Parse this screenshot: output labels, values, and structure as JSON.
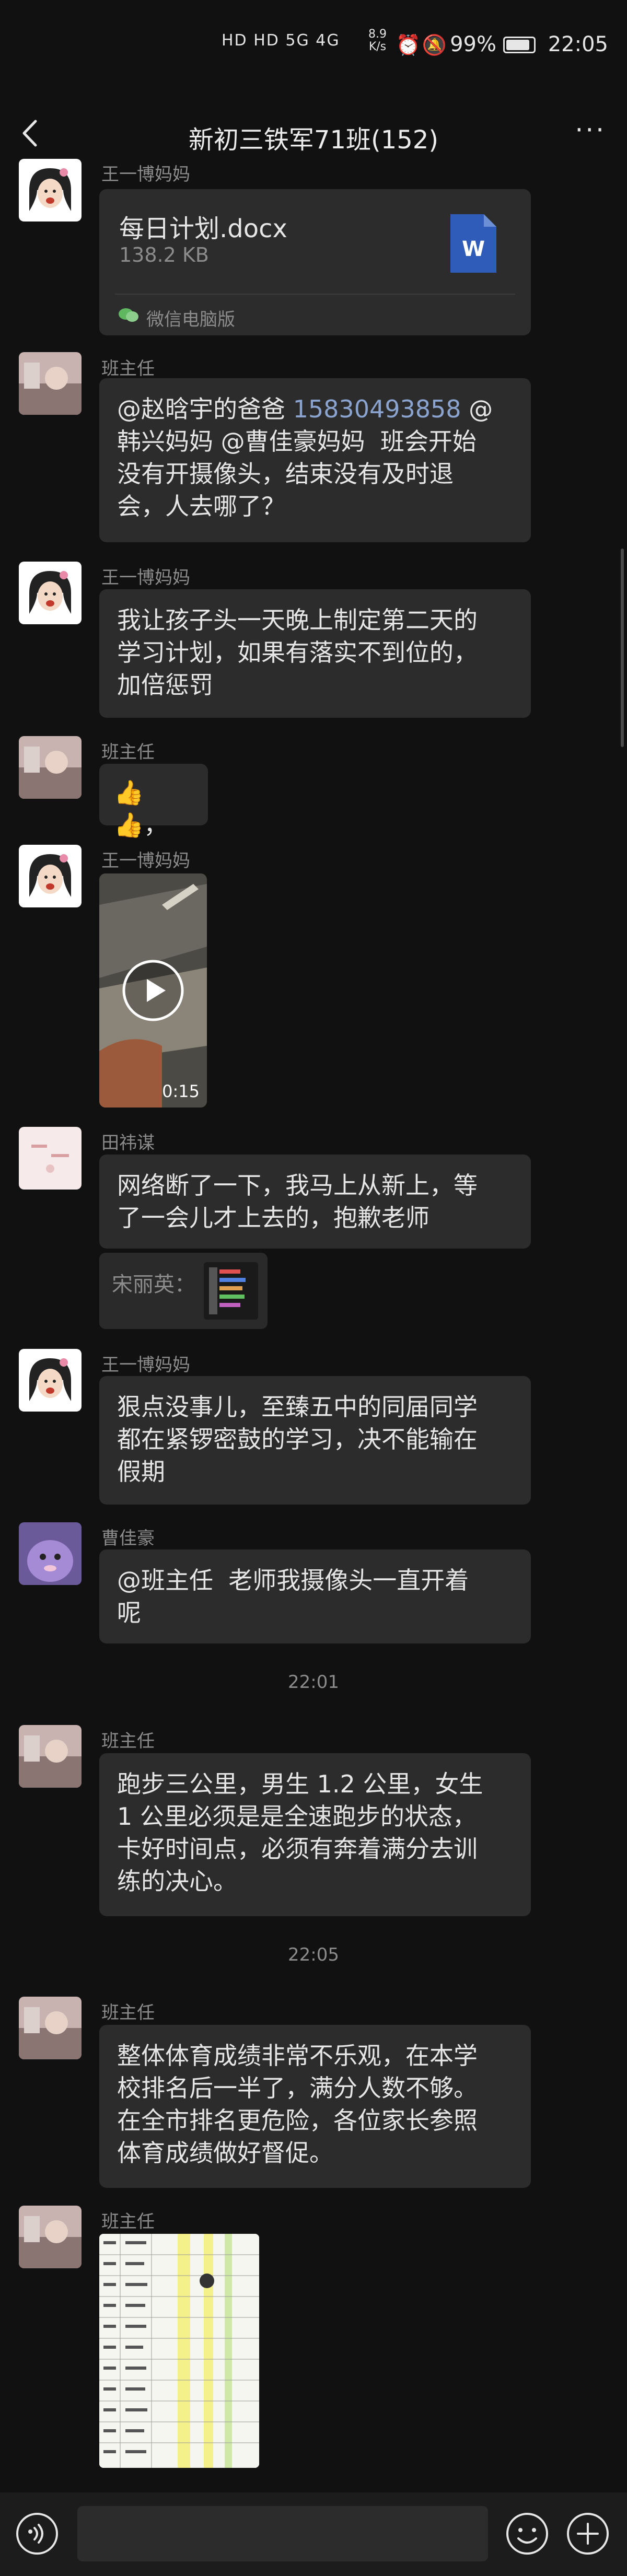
{
  "status_bar": {
    "time": "22:05",
    "battery": "99%",
    "net_speed": "8.9\nK/s",
    "signal": "HD HD 5G 4G"
  },
  "header": {
    "title": "新初三铁军71班(152)"
  },
  "messages": [
    {
      "sender": "王一博妈妈",
      "file_name": "每日计划.docx",
      "file_size": "138.2 KB",
      "file_source": "微信电脑版"
    },
    {
      "sender": "班主任",
      "parts": [
        "@赵晗宇的爸爸 ",
        "15830493858",
        " @\n韩兴妈妈 @曹佳豪妈妈  班会开始\n没有开摄像头，结束没有及时退\n会，人去哪了？"
      ]
    },
    {
      "sender": "王一博妈妈",
      "text": "我让孩子头一天晚上制定第二天的\n学习计划，如果有落实不到位的，\n加倍惩罚"
    },
    {
      "sender": "班主任",
      "text": "👍👍，"
    },
    {
      "sender": "王一博妈妈",
      "video_duration": "0:15"
    },
    {
      "sender": "田祎谋",
      "text": "网络断了一下，我马上从新上，等\n了一会儿才上去的，抱歉老师",
      "quote": "宋丽英："
    },
    {
      "sender": "王一博妈妈",
      "text": "狠点没事儿，至臻五中的同届同学\n都在紧锣密鼓的学习，决不能输在\n假期"
    },
    {
      "sender": "曹佳豪",
      "text": "@班主任  老师我摄像头一直开着\n呢"
    },
    {
      "timestamp": "22:01"
    },
    {
      "sender": "班主任",
      "text": "跑步三公里，男生 1.2 公里，女生\n1 公里必须是是全速跑步的状态，\n卡好时间点，必须有奔着满分去训\n练的决心。"
    },
    {
      "timestamp": "22:05"
    },
    {
      "sender": "班主任",
      "text": "整体体育成绩非常不乐观，在本学\n校排名后一半了，满分人数不够。\n在全市排名更危险，各位家长参照\n体育成绩做好督促。"
    },
    {
      "sender": "班主任",
      "image": "photo"
    }
  ],
  "input": {
    "placeholder": ""
  }
}
